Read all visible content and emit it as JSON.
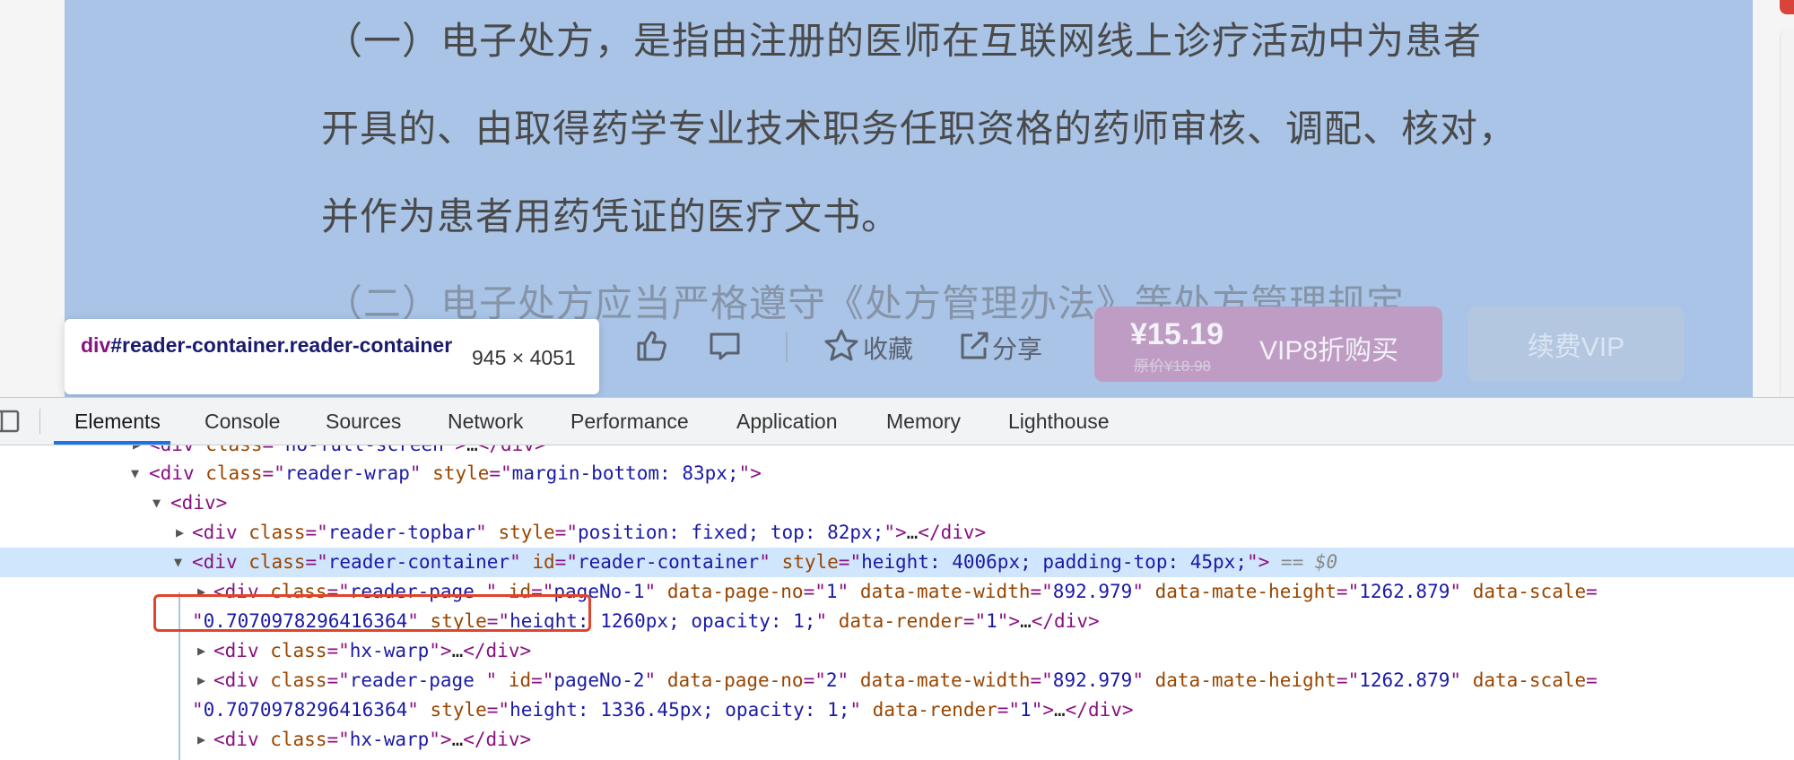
{
  "document": {
    "lines": [
      "（一）电子处方，是指由注册的医师在互联网线上诊疗活动中为患者",
      "开具的、由取得药学专业技术职务任职资格的药师审核、调配、核对，",
      "并作为患者用药凭证的医疗文书。",
      "（二）电子处方应当严格遵守《处方管理办法》等处方管理规定"
    ]
  },
  "action_bar": {
    "favorite_label": "收藏",
    "share_label": "分享",
    "buy": {
      "price": "¥15.19",
      "original_price": "原价¥18.98",
      "label": "VIP8折购买"
    },
    "renew_label": "续费VIP"
  },
  "tooltip": {
    "tag": "div",
    "selector_rest": "#reader-container.reader-container",
    "size": "945 × 4051"
  },
  "devtools": {
    "tabs": [
      "Elements",
      "Console",
      "Sources",
      "Network",
      "Performance",
      "Application",
      "Memory",
      "Lighthouse"
    ],
    "active_tab": "Elements"
  },
  "dom": {
    "l0": {
      "tag": "div",
      "class_attr": "class",
      "class_val": "no-full-screen",
      "ellipsis": "…"
    },
    "l1": {
      "tag": "div",
      "class_val": "reader-wrap",
      "style_attr": "style",
      "style_val": "margin-bottom: 83px;"
    },
    "l2": {
      "tag": "div"
    },
    "l3": {
      "tag": "div",
      "class_val": "reader-topbar",
      "style_val": "position: fixed; top: 82px;",
      "ellipsis": "…"
    },
    "l4": {
      "tag": "div",
      "class_val": "reader-container",
      "id_attr": "id",
      "id_val": "reader-container",
      "style_val": "height: 4006px; padding-top: 45px;",
      "eq": "==",
      "dollar": "$0"
    },
    "l5": {
      "tag": "div",
      "class_val": "reader-page ",
      "id_val": "pageNo-1",
      "pn_attr": "data-page-no",
      "pn_val": "1",
      "mw_attr": "data-mate-width",
      "mw_val": "892.979",
      "mh_attr": "data-mate-height",
      "mh_val": "1262.879",
      "scale_attr": "data-scale"
    },
    "l6": {
      "scale_val": "0.7070978296416364",
      "style_val": "height: 1260px; opacity: 1;",
      "render_attr": "data-render",
      "render_val": "1",
      "ellipsis": "…"
    },
    "l7": {
      "tag": "div",
      "class_val": "hx-warp",
      "ellipsis": "…"
    },
    "l8": {
      "tag": "div",
      "class_val": "reader-page ",
      "id_val": "pageNo-2",
      "pn_val": "2",
      "mw_val": "892.979",
      "mh_val": "1262.879"
    },
    "l9": {
      "scale_val": "0.7070978296416364",
      "style_val": "height: 1336.45px; opacity: 1;",
      "render_val": "1",
      "ellipsis": "…"
    },
    "l10": {
      "tag": "div",
      "class_val": "hx-warp",
      "ellipsis": "…"
    }
  },
  "colors": {
    "highlight": "#a9c4e6",
    "buy_button": "#bf9cc3",
    "tab_active_underline": "#1a73e8",
    "selected_row": "#cfe6fc",
    "annotation_box": "#e0442c"
  }
}
